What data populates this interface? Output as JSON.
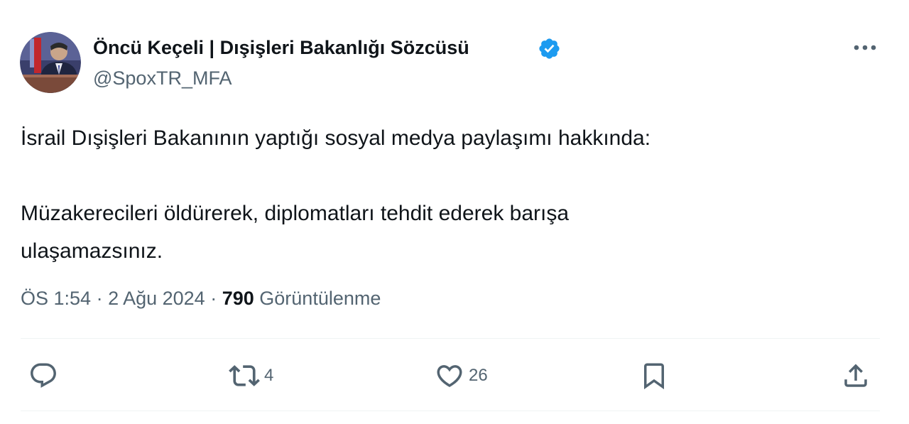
{
  "author": {
    "display_name": "Öncü Keçeli | Dışişleri Bakanlığı Sözcüsü",
    "handle": "@SpoxTR_MFA",
    "verified": true,
    "verified_color": "#1d9bf0",
    "avatar_icon": "profile-photo"
  },
  "tweet": {
    "paragraph_1": "İsrail Dışişleri Bakanının yaptığı sosyal medya paylaşımı hakkında:",
    "paragraph_2": "Müzakerecileri öldürerek, diplomatları tehdit ederek barışa\nulaşamazsınız."
  },
  "meta": {
    "time": "ÖS 1:54",
    "separator": " · ",
    "date": "2 Ağu 2024",
    "views_count": "790",
    "views_label": "Görüntülenme"
  },
  "actions": {
    "reply_icon": "speech-bubble-icon",
    "retweet_icon": "retweet-arrows-icon",
    "retweet_count": "4",
    "like_icon": "heart-icon",
    "like_count": "26",
    "bookmark_icon": "bookmark-icon",
    "share_icon": "share-upload-icon"
  },
  "colors": {
    "text_primary": "#0f1419",
    "text_secondary": "#536471",
    "divider": "#eff3f4"
  }
}
